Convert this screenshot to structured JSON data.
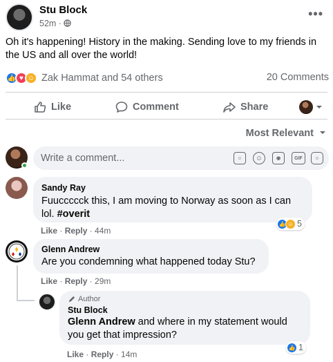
{
  "post": {
    "author": "Stu Block",
    "time": "52m · ",
    "privacy_icon": "globe-icon",
    "text": "Oh it's happening! History in the making. Sending love to my friends in the US and all over the world!",
    "reaction_names": "Zak Hammat and 54 others",
    "comments_count": "20 Comments"
  },
  "actions": {
    "like": "Like",
    "comment": "Comment",
    "share": "Share"
  },
  "sort": {
    "label": "Most Relevant"
  },
  "composer": {
    "placeholder": "Write a comment..."
  },
  "comments": [
    {
      "name": "Sandy Ray",
      "text": "Fuuccccck this, I am moving to Norway as soon as I can lol. ",
      "hashtag": "#overit",
      "like": "Like",
      "reply": "Reply",
      "time": "44m",
      "reactions": "5"
    },
    {
      "name": "Glenn Andrew",
      "text": "Are you condemning what happened today Stu?",
      "like": "Like",
      "reply": "Reply",
      "time": "29m"
    }
  ],
  "reply": {
    "badge": "Author",
    "name": "Stu Block",
    "mention": "Glenn Andrew",
    "text": " and where in my statement would you get that impression?",
    "like": "Like",
    "reply": "Reply",
    "time": "14m",
    "reactions": "1"
  },
  "colors": {
    "like_blue": "#1877f2",
    "love_red": "#f33e58",
    "haha_yellow": "#f7b125",
    "muted": "#65676b",
    "bubble": "#f0f2f5"
  }
}
